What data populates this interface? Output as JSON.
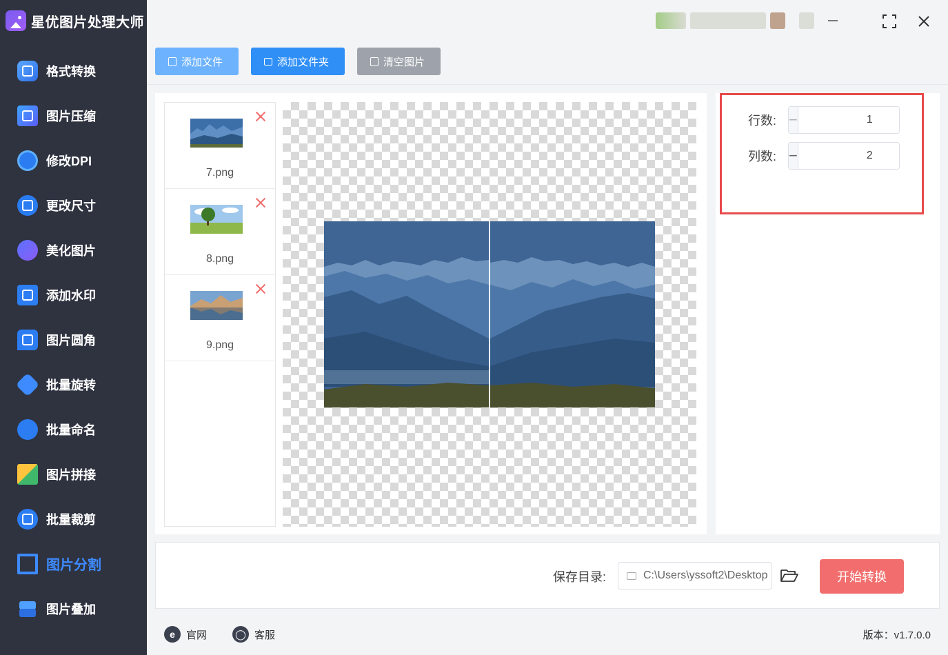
{
  "app": {
    "title": "星优图片处理大师"
  },
  "sidebar": {
    "items": [
      {
        "label": "格式转换",
        "icon": "format-convert-icon"
      },
      {
        "label": "图片压缩",
        "icon": "compress-icon"
      },
      {
        "label": "修改DPI",
        "icon": "dpi-icon"
      },
      {
        "label": "更改尺寸",
        "icon": "resize-icon"
      },
      {
        "label": "美化图片",
        "icon": "beautify-icon"
      },
      {
        "label": "添加水印",
        "icon": "watermark-icon"
      },
      {
        "label": "图片圆角",
        "icon": "round-corner-icon"
      },
      {
        "label": "批量旋转",
        "icon": "rotate-icon"
      },
      {
        "label": "批量命名",
        "icon": "rename-icon"
      },
      {
        "label": "图片拼接",
        "icon": "stitch-icon"
      },
      {
        "label": "批量裁剪",
        "icon": "crop-icon"
      },
      {
        "label": "图片分割",
        "icon": "split-icon",
        "active": true
      },
      {
        "label": "图片叠加",
        "icon": "overlay-icon"
      }
    ]
  },
  "toolbar": {
    "add_file": "添加文件",
    "add_folder": "添加文件夹",
    "clear": "清空图片"
  },
  "files": [
    {
      "name": "7.png"
    },
    {
      "name": "8.png"
    },
    {
      "name": "9.png"
    }
  ],
  "settings": {
    "rows_label": "行数:",
    "rows_value": "1",
    "cols_label": "列数:",
    "cols_value": "2",
    "highlight_color": "#e84a4a"
  },
  "output": {
    "save_label": "保存目录:",
    "save_path": "C:\\Users\\yssoft2\\Desktop",
    "start_button": "开始转换"
  },
  "footer": {
    "website": "官网",
    "support": "客服",
    "version": "版本：v1.7.0.0"
  },
  "colors": {
    "sidebar_bg": "#2f3340",
    "accent": "#3d8bff",
    "start_button": "#f26e6e"
  }
}
